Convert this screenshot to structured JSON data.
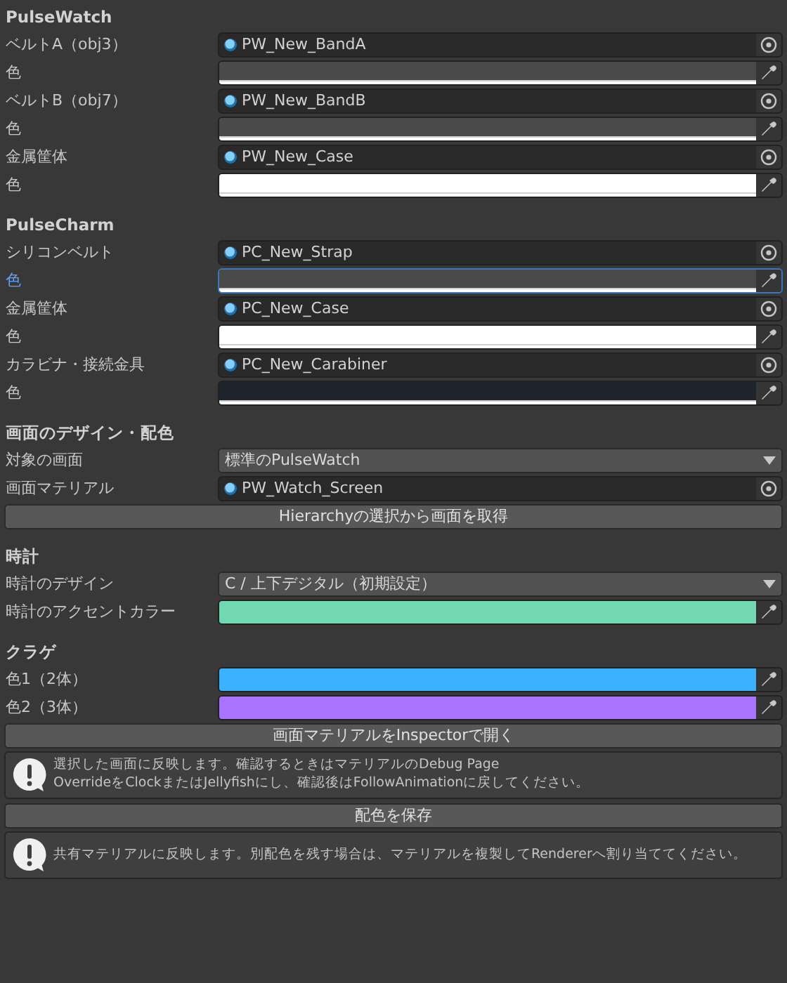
{
  "sections": [
    {
      "title": "PulseWatch",
      "items": [
        {
          "kind": "object",
          "label": "ベルトA（obj3）",
          "value": "PW_New_BandA"
        },
        {
          "kind": "color",
          "label": "色",
          "color": "#4a4a4a",
          "alpha_bar": true,
          "focused": false
        },
        {
          "kind": "object",
          "label": "ベルトB（obj7）",
          "value": "PW_New_BandB"
        },
        {
          "kind": "color",
          "label": "色",
          "color": "#4a4a4a",
          "alpha_bar": true,
          "focused": false
        },
        {
          "kind": "object",
          "label": "金属筐体",
          "value": "PW_New_Case"
        },
        {
          "kind": "color",
          "label": "色",
          "color": "#ffffff",
          "alpha_bar": true,
          "focused": false
        }
      ]
    },
    {
      "title": "PulseCharm",
      "items": [
        {
          "kind": "object",
          "label": "シリコンベルト",
          "value": "PC_New_Strap"
        },
        {
          "kind": "color",
          "label": "色",
          "color": "#4a4a4a",
          "alpha_bar": true,
          "focused": true
        },
        {
          "kind": "object",
          "label": "金属筐体",
          "value": "PC_New_Case"
        },
        {
          "kind": "color",
          "label": "色",
          "color": "#ffffff",
          "alpha_bar": true,
          "focused": false
        },
        {
          "kind": "object",
          "label": "カラビナ・接続金具",
          "value": "PC_New_Carabiner"
        },
        {
          "kind": "color",
          "label": "色",
          "color": "#1f252c",
          "alpha_bar": true,
          "focused": false
        }
      ]
    },
    {
      "title": "画面のデザイン・配色",
      "items": [
        {
          "kind": "dropdown",
          "label": "対象の画面",
          "value": "標準のPulseWatch"
        },
        {
          "kind": "object",
          "label": "画面マテリアル",
          "value": "PW_Watch_Screen"
        },
        {
          "kind": "button",
          "text": "Hierarchyの選択から画面を取得"
        }
      ]
    },
    {
      "title": "時計",
      "items": [
        {
          "kind": "dropdown",
          "label": "時計のデザイン",
          "value": "C / 上下デジタル（初期設定）"
        },
        {
          "kind": "color",
          "label": "時計のアクセントカラー",
          "color": "#72d8b2",
          "alpha_bar": false,
          "focused": false
        }
      ]
    },
    {
      "title": "クラゲ",
      "items": [
        {
          "kind": "color",
          "label": "色1（2体）",
          "color": "#3bb1ff",
          "alpha_bar": false,
          "focused": false
        },
        {
          "kind": "color",
          "label": "色2（3体）",
          "color": "#a874ff",
          "alpha_bar": false,
          "focused": false
        },
        {
          "kind": "button",
          "text": "画面マテリアルをInspectorで開く"
        },
        {
          "kind": "help",
          "lines": [
            "選択した画面に反映します。確認するときはマテリアルのDebug Page",
            "OverrideをClockまたはJellyfishにし、確認後はFollowAnimationに戻してください。"
          ]
        },
        {
          "kind": "button",
          "text": "配色を保存"
        },
        {
          "kind": "help",
          "lines": [
            "共有マテリアルに反映します。別配色を残す場合は、マテリアルを複製してRendererへ割り当ててください。"
          ]
        }
      ]
    }
  ]
}
